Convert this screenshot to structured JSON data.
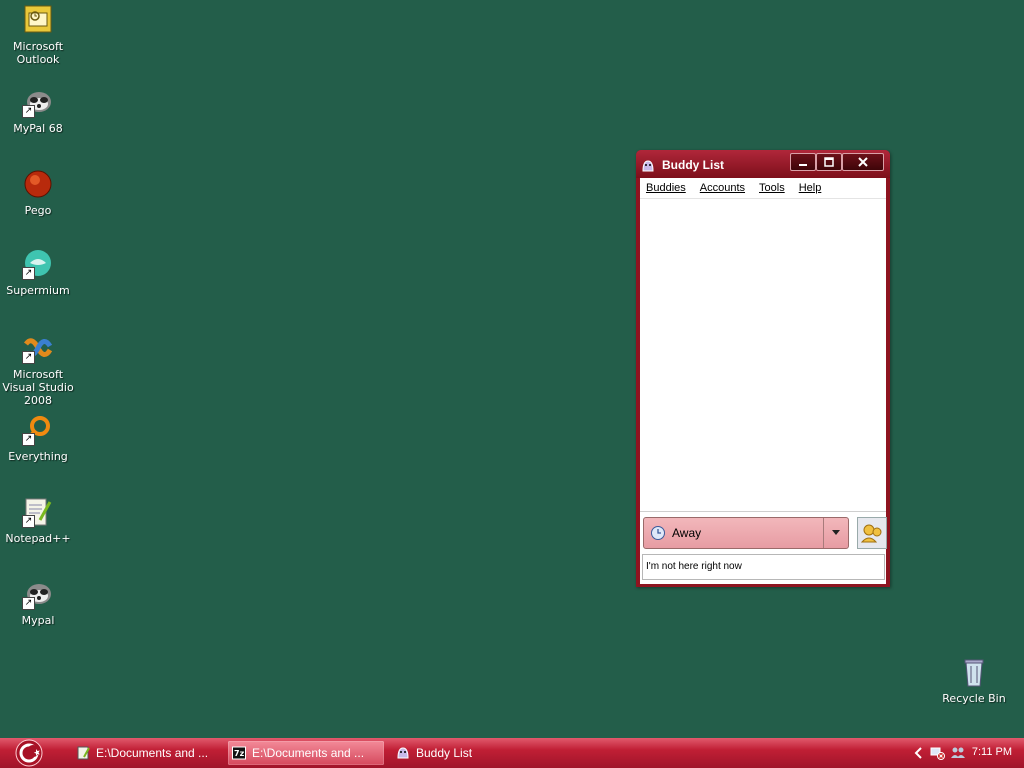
{
  "desktop": {
    "background_color": "#235e4a",
    "icons": [
      {
        "label": "Microsoft Outlook",
        "icon": "outlook-icon"
      },
      {
        "label": "MyPal 68",
        "icon": "mypal-icon"
      },
      {
        "label": "Pego",
        "icon": "pego-icon"
      },
      {
        "label": "Supermium",
        "icon": "supermium-icon"
      },
      {
        "label": "Microsoft Visual Studio 2008",
        "icon": "visual-studio-icon"
      },
      {
        "label": "Everything",
        "icon": "everything-icon"
      },
      {
        "label": "Notepad++",
        "icon": "notepadpp-icon"
      },
      {
        "label": "Mypal",
        "icon": "mypal-icon"
      }
    ],
    "recycle_bin": {
      "label": "Recycle Bin",
      "icon": "recycle-bin-icon"
    }
  },
  "buddy_window": {
    "title": "Buddy List",
    "menu": [
      "Buddies",
      "Accounts",
      "Tools",
      "Help"
    ],
    "status": "Away",
    "status_message": "I'm not here right now",
    "titlebar_color": "#8e1420"
  },
  "taskbar": {
    "items": [
      {
        "label": "E:\\Documents and ...",
        "icon": "notepad-icon"
      },
      {
        "label": "E:\\Documents and ...",
        "icon": "7zip-icon",
        "active": true
      },
      {
        "label": "Buddy List",
        "icon": "pidgin-icon"
      }
    ],
    "clock": "7:11 PM",
    "accent_color": "#c01f35"
  }
}
